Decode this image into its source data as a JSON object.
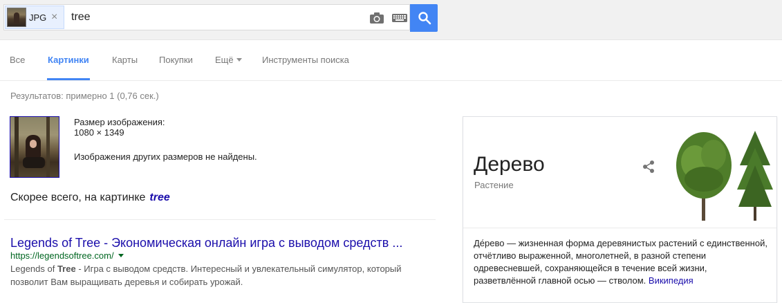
{
  "search": {
    "chip_label": "JPG",
    "chip_close": "×",
    "query": "tree"
  },
  "tabs": [
    {
      "label": "Все"
    },
    {
      "label": "Картинки"
    },
    {
      "label": "Карты"
    },
    {
      "label": "Покупки"
    },
    {
      "label": "Ещё"
    },
    {
      "label": "Инструменты поиска"
    }
  ],
  "stats": "Результатов: примерно 1 (0,76 сек.)",
  "image_info": {
    "size_label": "Размер изображения:",
    "size_value": "1080 × 1349",
    "not_found": "Изображения других размеров не найдены."
  },
  "best_guess": {
    "label": "Скорее всего, на картинке",
    "term": "tree"
  },
  "result": {
    "title": "Legends of Tree - Экономическая онлайн игра с выводом средств ...",
    "url": "https://legendsoftree.com/",
    "snippet_bold": "Tree",
    "snippet_prefix": "Legends of ",
    "snippet_rest": " - Игра с выводом средств. Интересный и увлекательный симулятор, который позволит Вам выращивать деревья и собирать урожай."
  },
  "knowledge_panel": {
    "title": "Дерево",
    "subtitle": "Растение",
    "description": "Де́рево — жизненная форма деревянистых растений с единственной, отчётливо выраженной, многолетней, в разной степени одревесневшей, сохраняющейся в течение всей жизни, разветвлённой главной осью — стволом.",
    "source_link": "Википедия"
  },
  "colors": {
    "accent": "#4285f4",
    "link": "#1a0dab",
    "url_green": "#006621"
  }
}
